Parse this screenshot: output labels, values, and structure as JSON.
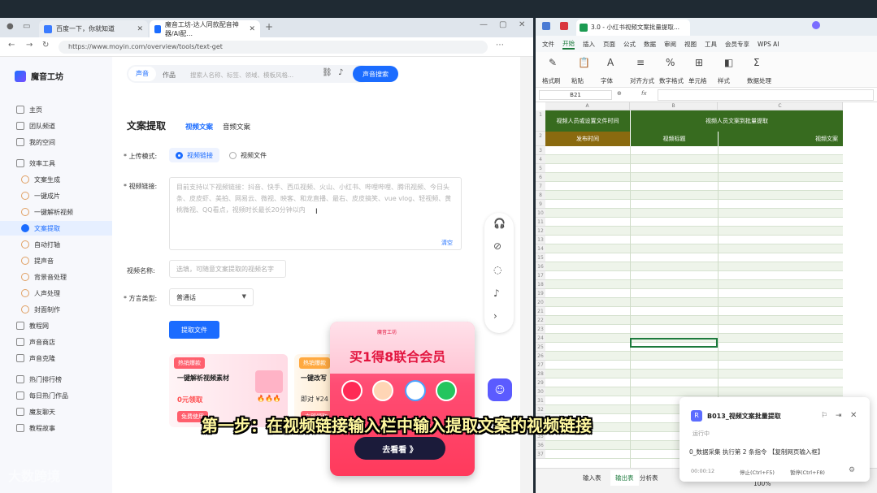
{
  "browser": {
    "tabs": [
      {
        "label": "百度一下，你就知道"
      },
      {
        "label": "魔音工坊-达人同款配音神器/AI配..."
      }
    ],
    "url": "https://www.moyin.com/overview/tools/text-get",
    "new_tab": "+"
  },
  "site": {
    "logo": "魔音工坊",
    "top": {
      "tab_voice": "声音",
      "tab_work": "作品",
      "search_placeholder": "搜索人名称、标签、领域、模板风格...",
      "search_button": "声音搜索"
    },
    "sidebar": [
      {
        "label": "主页"
      },
      {
        "label": "团队频道"
      },
      {
        "label": "我的空间"
      },
      {
        "label": "效率工具"
      },
      {
        "label": "文案生成"
      },
      {
        "label": "一键成片"
      },
      {
        "label": "一键解析视频"
      },
      {
        "label": "文案提取"
      },
      {
        "label": "自动打轴"
      },
      {
        "label": "提声音"
      },
      {
        "label": "背景音处理"
      },
      {
        "label": "人声处理"
      },
      {
        "label": "封面制作"
      },
      {
        "label": "教程网"
      },
      {
        "label": "声音商店"
      },
      {
        "label": "声音克隆"
      },
      {
        "label": "热门排行榜"
      },
      {
        "label": "每日热门作品"
      },
      {
        "label": "魔友聊天"
      },
      {
        "label": "教程故事"
      }
    ],
    "page_title": "文案提取",
    "page_tabs": [
      "视频文案",
      "音频文案"
    ],
    "form": {
      "upload_label": "* 上传模式:",
      "mode_link": "视频链接",
      "mode_file": "视频文件",
      "link_label": "* 视频链接:",
      "link_placeholder": "目前支持以下视频链接：抖音、快手、西瓜视频、火山、小红书、哔哩哔哩、腾讯视频、今日头条、皮皮虾、美拍、网易云、微视、映客、和龙直播、最右、皮皮搞笑、vue vlog、轻视频、黄桃微视、QQ看点，视频时长最长20分钟以内",
      "clear": "清空",
      "name_label": "视频名称:",
      "name_placeholder": "选填，可随意文案提取的视频名字",
      "dialect_label": "* 方言类型:",
      "dialect_value": "普通话",
      "submit": "提取文件"
    },
    "cards": [
      {
        "tag": "热销爆款",
        "title": "一键解析视频素材",
        "price": "0元领取",
        "action": "免费使用"
      },
      {
        "tag": "热销爆款",
        "title": "一键改写",
        "price": "即对 ¥24",
        "action": "立即领取"
      }
    ],
    "ad": {
      "brand": "魔音工坊",
      "title": "买1得8联合会员",
      "button": "去看看 》"
    }
  },
  "sheet": {
    "tab_title": "3.0 - 小红书视频文案批量提取...",
    "menu": [
      "文件",
      "开始",
      "插入",
      "页面",
      "公式",
      "数据",
      "审阅",
      "视图",
      "工具",
      "会员专享",
      "WPS AI"
    ],
    "active_menu": "开始",
    "ribbon": [
      "格式刷",
      "粘贴",
      "字体",
      "对齐方式",
      "数字格式",
      "单元格",
      "样式",
      "数据处理"
    ],
    "cell_ref": "B21",
    "fx": "fx",
    "header1": "视频人员或设置文件时间",
    "header2": "视频人员文案到批量提取",
    "sub1": "发布时间",
    "sub2": "视频标题",
    "sub3": "视频文案",
    "col_a": "A",
    "col_b": "B",
    "col_c": "C",
    "rows": [
      "1",
      "2",
      "3",
      "4",
      "5",
      "6",
      "7",
      "8",
      "9",
      "10",
      "11",
      "12",
      "13",
      "14",
      "15",
      "16",
      "17",
      "18",
      "19",
      "20",
      "21",
      "22",
      "23",
      "24",
      "25",
      "26",
      "27",
      "28",
      "29",
      "30",
      "31",
      "32",
      "33",
      "34",
      "35",
      "36",
      "37"
    ],
    "sheet_tabs": [
      "输入表",
      "输出表",
      "分析表"
    ],
    "zoom": "100%"
  },
  "notification": {
    "title": "B013_视频文案批量提取",
    "subtitle": "运行中",
    "message": "0_数据采集 执行第 2 条指令 【复制网页输入框】",
    "time": "00:00:12",
    "stop": "停止(Ctrl+F5)",
    "pause": "暂停(Ctrl+F8)"
  },
  "caption": "第一步：在视频链接输入栏中输入提取文案的视频链接",
  "watermark": "大数跨境"
}
